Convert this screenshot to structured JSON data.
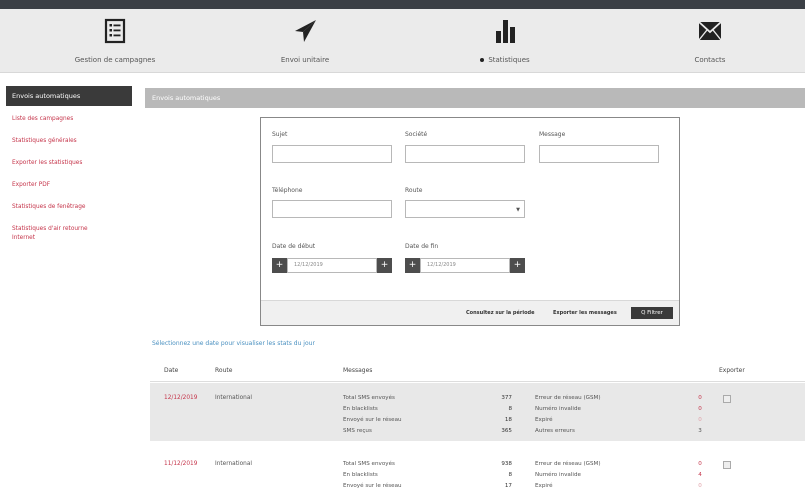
{
  "nav": {
    "items": [
      {
        "label": "Gestion de campagnes",
        "icon": "list-icon"
      },
      {
        "label": "Envoi unitaire",
        "icon": "paper-plane-icon"
      },
      {
        "label": "Statistiques",
        "icon": "bar-chart-icon",
        "active": true
      },
      {
        "label": "Contacts",
        "icon": "envelope-icon"
      }
    ]
  },
  "sidebar": {
    "active": "Envois automatiques",
    "links": [
      "Liste des campagnes",
      "Statistiques générales",
      "Exporter les statistiques",
      "Exporter PDF",
      "Statistiques de fenêtrage",
      "Statistiques d'air retourne",
      "Internet"
    ]
  },
  "section_title": "Envois automatiques",
  "filter": {
    "sujet_label": "Sujet",
    "societe_label": "Société",
    "message_label": "Message",
    "telephone_label": "Téléphone",
    "route_label": "Route",
    "date_debut_label": "Date de début",
    "date_fin_label": "Date de fin",
    "date_debut_value": "12/12/2019",
    "date_fin_value": "12/12/2019",
    "consult_link": "Consultez sur la période",
    "export_link": "Exporter les messages",
    "filter_button": "Q Filtrer"
  },
  "info_text": "Sélectionnez une date pour visualiser les stats du jour",
  "table": {
    "headers": {
      "date": "Date",
      "route": "Route",
      "messages": "Messages",
      "export": "Exporter"
    },
    "rows": [
      {
        "date": "12/12/2019",
        "route": "International",
        "stats": [
          {
            "label": "Total SMS envoyés",
            "value": "377"
          },
          {
            "label": "En blacklists",
            "value": "8"
          },
          {
            "label": "Envoyé sur le réseau",
            "value": "18"
          },
          {
            "label": "SMS reçus",
            "value": "365"
          }
        ],
        "errors": [
          {
            "label": "Erreur de réseau (GSM)",
            "value": "0"
          },
          {
            "label": "Numéro invalide",
            "value": "0"
          },
          {
            "label": "Expiré",
            "value": "0"
          },
          {
            "label": "Autres erreurs",
            "value": "3"
          }
        ]
      },
      {
        "date": "11/12/2019",
        "route": "International",
        "stats": [
          {
            "label": "Total SMS envoyés",
            "value": "938"
          },
          {
            "label": "En blacklists",
            "value": "8"
          },
          {
            "label": "Envoyé sur le réseau",
            "value": "17"
          }
        ],
        "errors": [
          {
            "label": "Erreur de réseau (GSM)",
            "value": "0"
          },
          {
            "label": "Numéro invalide",
            "value": "4"
          },
          {
            "label": "Expiré",
            "value": "0"
          }
        ]
      }
    ]
  },
  "colors": {
    "accent": "#c5344a",
    "dark": "#3a3a3a",
    "section": "#b9b9b9",
    "info": "#4a90c0"
  }
}
